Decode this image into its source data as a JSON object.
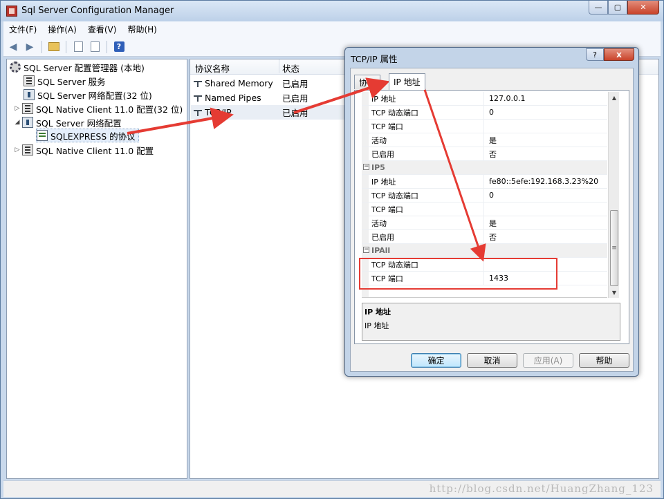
{
  "window": {
    "title": "Sql Server Configuration Manager"
  },
  "menu": [
    "文件(F)",
    "操作(A)",
    "查看(V)",
    "帮助(H)"
  ],
  "tree": {
    "root": "SQL Server 配置管理器 (本地)",
    "items": [
      {
        "label": "SQL Server 服务",
        "icon": "server-icon"
      },
      {
        "label": "SQL Server 网络配置(32 位)",
        "icon": "network-icon"
      },
      {
        "label": "SQL Native Client 11.0 配置(32 位)",
        "icon": "client-icon"
      },
      {
        "label": "SQL Server 网络配置",
        "icon": "network-icon"
      },
      {
        "label": "SQLEXPRESS 的协议",
        "icon": "protocol-icon"
      },
      {
        "label": "SQL Native Client 11.0 配置",
        "icon": "client-icon"
      }
    ]
  },
  "list": {
    "columns": [
      "协议名称",
      "状态"
    ],
    "rows": [
      {
        "name": "Shared Memory",
        "status": "已启用"
      },
      {
        "name": "Named Pipes",
        "status": "已启用"
      },
      {
        "name": "TCP/IP",
        "status": "已启用"
      }
    ]
  },
  "dialog": {
    "title": "TCP/IP 属性",
    "help_glyph": "?",
    "close_glyph": "x",
    "tabs": [
      "协议",
      "IP 地址"
    ],
    "grid_rows": [
      {
        "type": "prop",
        "key": "IP 地址",
        "value": "127.0.0.1"
      },
      {
        "type": "prop",
        "key": "TCP 动态端口",
        "value": "0"
      },
      {
        "type": "prop",
        "key": "TCP 端口",
        "value": ""
      },
      {
        "type": "prop",
        "key": "活动",
        "value": "是"
      },
      {
        "type": "prop",
        "key": "已启用",
        "value": "否"
      },
      {
        "type": "cat",
        "key": "IP5",
        "value": ""
      },
      {
        "type": "prop",
        "key": "IP 地址",
        "value": "fe80::5efe:192.168.3.23%20"
      },
      {
        "type": "prop",
        "key": "TCP 动态端口",
        "value": "0"
      },
      {
        "type": "prop",
        "key": "TCP 端口",
        "value": ""
      },
      {
        "type": "prop",
        "key": "活动",
        "value": "是"
      },
      {
        "type": "prop",
        "key": "已启用",
        "value": "否"
      },
      {
        "type": "cat",
        "key": "IPAll",
        "value": ""
      },
      {
        "type": "prop",
        "key": "TCP 动态端口",
        "value": ""
      },
      {
        "type": "prop",
        "key": "TCP 端口",
        "value": "1433"
      }
    ],
    "description": {
      "title": "IP 地址",
      "text": "IP 地址"
    },
    "buttons": {
      "ok": "确定",
      "cancel": "取消",
      "apply": "应用(A)",
      "help": "帮助"
    }
  },
  "watermark": "http://blog.csdn.net/HuangZhang_123",
  "colors": {
    "annotation_red": "#e53b33",
    "titlebar": "#c9d9ec"
  }
}
